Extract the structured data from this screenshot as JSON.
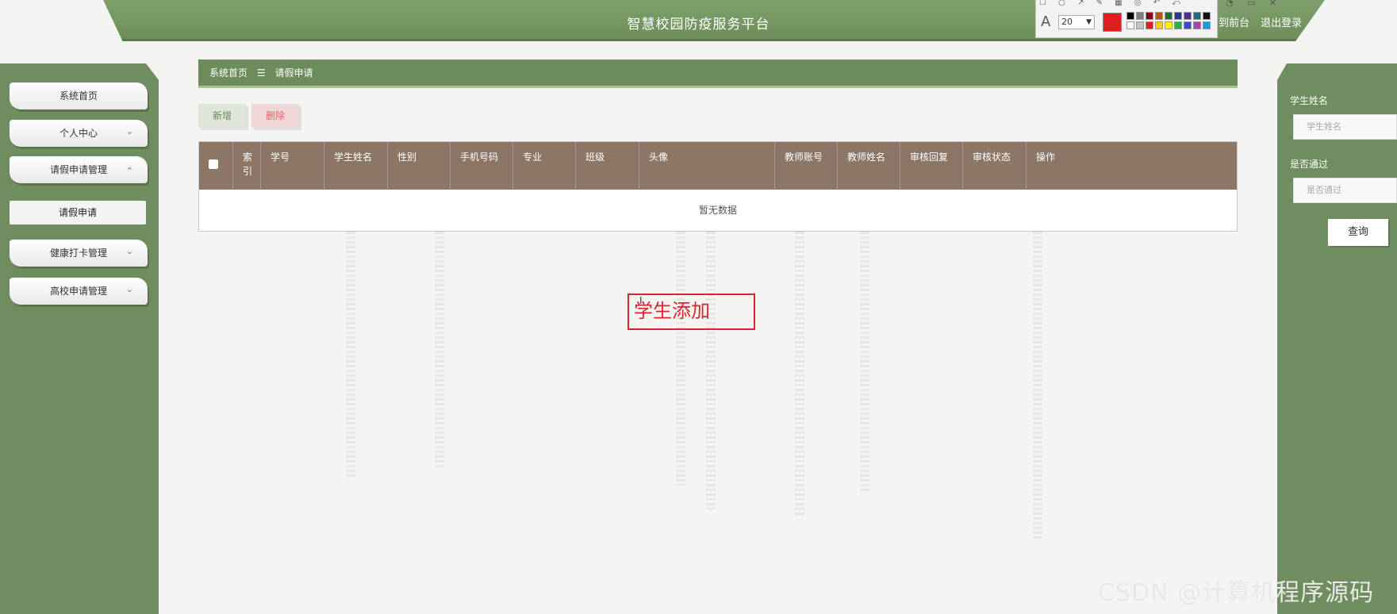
{
  "header": {
    "title": "智慧校园防疫服务平台",
    "links": [
      "到前台",
      "退出登录"
    ]
  },
  "annotation_toolbar": {
    "font_glyph": "A",
    "font_size": "20",
    "caret": "▼",
    "current_color": "#e0201f",
    "palette": [
      "#000000",
      "#7f7f7f",
      "#880015",
      "#b5561e",
      "#1f6b34",
      "#2b3a8f",
      "#4b3190",
      "#2a6a78",
      "#111111",
      "#ffffff",
      "#c3c3c3",
      "#e0201f",
      "#ffc90e",
      "#fff200",
      "#22b14c",
      "#3f48cc",
      "#a349a4",
      "#00a2e8"
    ],
    "tool_icons": "☐ ○ ↗ ✎ ▦ ◎ ↶ ⤺",
    "window_icons": "◔ ▭ ✕"
  },
  "sidebar": {
    "items": [
      {
        "label": "系统首页",
        "chevron": ""
      },
      {
        "label": "个人中心",
        "chevron": "⌄"
      },
      {
        "label": "请假申请管理",
        "chevron": "⌃"
      },
      {
        "label": "请假申请",
        "chevron": ""
      },
      {
        "label": "健康打卡管理",
        "chevron": "⌄"
      },
      {
        "label": "高校申请管理",
        "chevron": "⌄"
      }
    ]
  },
  "breadcrumb": {
    "home": "系统首页",
    "separator": "☰",
    "current": "请假申请"
  },
  "actions": {
    "add": "新增",
    "delete": "删除"
  },
  "table": {
    "columns": [
      "索引",
      "学号",
      "学生姓名",
      "性别",
      "手机号码",
      "专业",
      "班级",
      "头像",
      "教师账号",
      "教师姓名",
      "审核回复",
      "审核状态",
      "操作"
    ],
    "empty_text": "暂无数据"
  },
  "annotation_text": "学生添加",
  "search": {
    "student_name_label": "学生姓名",
    "student_name_placeholder": "学生姓名",
    "approved_label": "是否通过",
    "approved_placeholder": "是否通过",
    "query_button": "查询"
  },
  "watermark": "CSDN @计算机程序源码",
  "colors": {
    "primary_green": "#6f8d5e",
    "table_header": "#8c7767",
    "annotation_red": "#d7262e"
  }
}
